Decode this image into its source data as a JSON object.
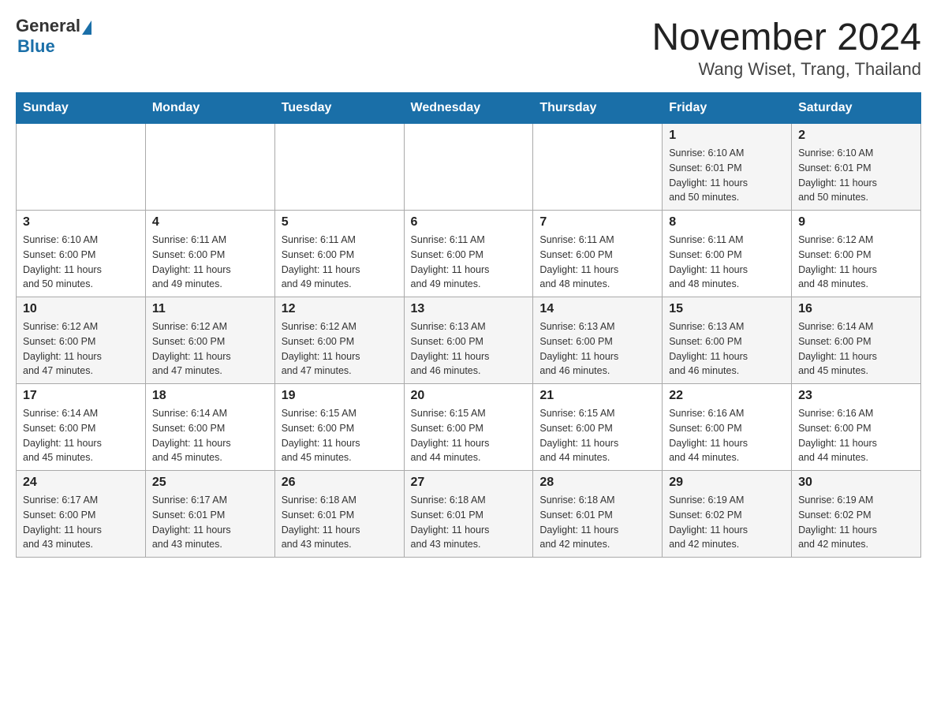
{
  "header": {
    "logo_general": "General",
    "logo_blue": "Blue",
    "month_title": "November 2024",
    "location": "Wang Wiset, Trang, Thailand"
  },
  "weekdays": [
    "Sunday",
    "Monday",
    "Tuesday",
    "Wednesday",
    "Thursday",
    "Friday",
    "Saturday"
  ],
  "weeks": [
    [
      {
        "day": "",
        "info": ""
      },
      {
        "day": "",
        "info": ""
      },
      {
        "day": "",
        "info": ""
      },
      {
        "day": "",
        "info": ""
      },
      {
        "day": "",
        "info": ""
      },
      {
        "day": "1",
        "info": "Sunrise: 6:10 AM\nSunset: 6:01 PM\nDaylight: 11 hours\nand 50 minutes."
      },
      {
        "day": "2",
        "info": "Sunrise: 6:10 AM\nSunset: 6:01 PM\nDaylight: 11 hours\nand 50 minutes."
      }
    ],
    [
      {
        "day": "3",
        "info": "Sunrise: 6:10 AM\nSunset: 6:00 PM\nDaylight: 11 hours\nand 50 minutes."
      },
      {
        "day": "4",
        "info": "Sunrise: 6:11 AM\nSunset: 6:00 PM\nDaylight: 11 hours\nand 49 minutes."
      },
      {
        "day": "5",
        "info": "Sunrise: 6:11 AM\nSunset: 6:00 PM\nDaylight: 11 hours\nand 49 minutes."
      },
      {
        "day": "6",
        "info": "Sunrise: 6:11 AM\nSunset: 6:00 PM\nDaylight: 11 hours\nand 49 minutes."
      },
      {
        "day": "7",
        "info": "Sunrise: 6:11 AM\nSunset: 6:00 PM\nDaylight: 11 hours\nand 48 minutes."
      },
      {
        "day": "8",
        "info": "Sunrise: 6:11 AM\nSunset: 6:00 PM\nDaylight: 11 hours\nand 48 minutes."
      },
      {
        "day": "9",
        "info": "Sunrise: 6:12 AM\nSunset: 6:00 PM\nDaylight: 11 hours\nand 48 minutes."
      }
    ],
    [
      {
        "day": "10",
        "info": "Sunrise: 6:12 AM\nSunset: 6:00 PM\nDaylight: 11 hours\nand 47 minutes."
      },
      {
        "day": "11",
        "info": "Sunrise: 6:12 AM\nSunset: 6:00 PM\nDaylight: 11 hours\nand 47 minutes."
      },
      {
        "day": "12",
        "info": "Sunrise: 6:12 AM\nSunset: 6:00 PM\nDaylight: 11 hours\nand 47 minutes."
      },
      {
        "day": "13",
        "info": "Sunrise: 6:13 AM\nSunset: 6:00 PM\nDaylight: 11 hours\nand 46 minutes."
      },
      {
        "day": "14",
        "info": "Sunrise: 6:13 AM\nSunset: 6:00 PM\nDaylight: 11 hours\nand 46 minutes."
      },
      {
        "day": "15",
        "info": "Sunrise: 6:13 AM\nSunset: 6:00 PM\nDaylight: 11 hours\nand 46 minutes."
      },
      {
        "day": "16",
        "info": "Sunrise: 6:14 AM\nSunset: 6:00 PM\nDaylight: 11 hours\nand 45 minutes."
      }
    ],
    [
      {
        "day": "17",
        "info": "Sunrise: 6:14 AM\nSunset: 6:00 PM\nDaylight: 11 hours\nand 45 minutes."
      },
      {
        "day": "18",
        "info": "Sunrise: 6:14 AM\nSunset: 6:00 PM\nDaylight: 11 hours\nand 45 minutes."
      },
      {
        "day": "19",
        "info": "Sunrise: 6:15 AM\nSunset: 6:00 PM\nDaylight: 11 hours\nand 45 minutes."
      },
      {
        "day": "20",
        "info": "Sunrise: 6:15 AM\nSunset: 6:00 PM\nDaylight: 11 hours\nand 44 minutes."
      },
      {
        "day": "21",
        "info": "Sunrise: 6:15 AM\nSunset: 6:00 PM\nDaylight: 11 hours\nand 44 minutes."
      },
      {
        "day": "22",
        "info": "Sunrise: 6:16 AM\nSunset: 6:00 PM\nDaylight: 11 hours\nand 44 minutes."
      },
      {
        "day": "23",
        "info": "Sunrise: 6:16 AM\nSunset: 6:00 PM\nDaylight: 11 hours\nand 44 minutes."
      }
    ],
    [
      {
        "day": "24",
        "info": "Sunrise: 6:17 AM\nSunset: 6:00 PM\nDaylight: 11 hours\nand 43 minutes."
      },
      {
        "day": "25",
        "info": "Sunrise: 6:17 AM\nSunset: 6:01 PM\nDaylight: 11 hours\nand 43 minutes."
      },
      {
        "day": "26",
        "info": "Sunrise: 6:18 AM\nSunset: 6:01 PM\nDaylight: 11 hours\nand 43 minutes."
      },
      {
        "day": "27",
        "info": "Sunrise: 6:18 AM\nSunset: 6:01 PM\nDaylight: 11 hours\nand 43 minutes."
      },
      {
        "day": "28",
        "info": "Sunrise: 6:18 AM\nSunset: 6:01 PM\nDaylight: 11 hours\nand 42 minutes."
      },
      {
        "day": "29",
        "info": "Sunrise: 6:19 AM\nSunset: 6:02 PM\nDaylight: 11 hours\nand 42 minutes."
      },
      {
        "day": "30",
        "info": "Sunrise: 6:19 AM\nSunset: 6:02 PM\nDaylight: 11 hours\nand 42 minutes."
      }
    ]
  ]
}
